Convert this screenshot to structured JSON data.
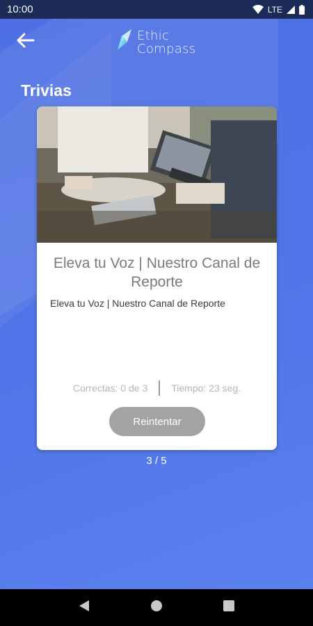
{
  "status_bar": {
    "time": "10:00",
    "network": "LTE"
  },
  "app": {
    "logo_line1": "Ethic",
    "logo_line2": "Compass"
  },
  "page": {
    "title": "Trivias"
  },
  "card": {
    "title": "Eleva tu Voz | Nuestro Canal de Reporte",
    "subtitle": "Eleva tu Voz | Nuestro Canal de Reporte",
    "correct": "Correctas: 0 de 3",
    "time": "Tiempo: 23 seg.",
    "retry_label": "Reintentar"
  },
  "pager": {
    "text": "3 / 5"
  },
  "colors": {
    "background": "#4f74e6",
    "status_bar": "#1b2a56",
    "retry": "#a3a3a3"
  }
}
